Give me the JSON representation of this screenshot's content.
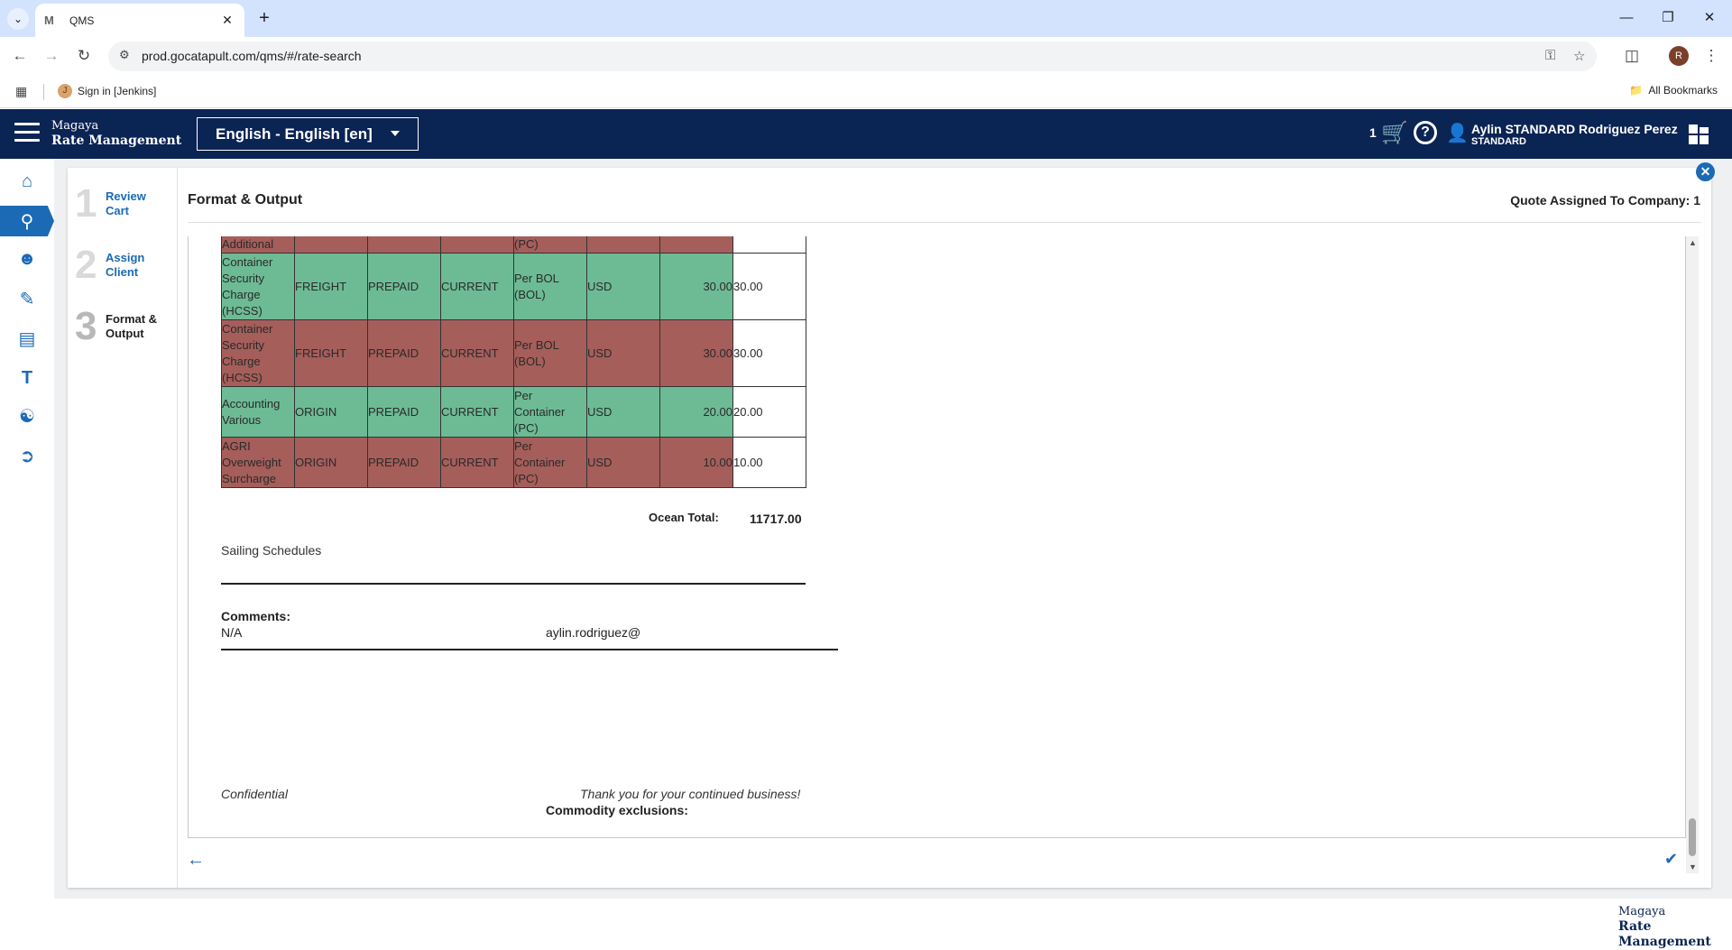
{
  "browser": {
    "tab_title": "QMS",
    "tab_favicon": "M",
    "url": "prod.gocatapult.com/qms/#/rate-search",
    "bookmark_label": "Sign in [Jenkins]",
    "all_bookmarks_label": "All Bookmarks",
    "profile_initial": "R"
  },
  "header": {
    "brand_top": "Magaya",
    "brand_bottom": "Rate Management",
    "language": "English - English [en]",
    "cart_count": "1",
    "user_name": "Aylin STANDARD Rodriguez Perez",
    "user_role": "STANDARD"
  },
  "wizard": {
    "steps": [
      {
        "number": "1",
        "label": "Review Cart"
      },
      {
        "number": "2",
        "label": "Assign Client"
      },
      {
        "number": "3",
        "label": "Format & Output"
      }
    ],
    "active_step": 3,
    "title": "Format & Output",
    "quote_assigned": "Quote Assigned To Company: 1"
  },
  "document": {
    "charges": [
      {
        "name": "Additional",
        "type": "",
        "payment": "",
        "status": "",
        "unit": "(PC)",
        "currency": "",
        "amount": "",
        "total": "",
        "color": "red",
        "partial": true
      },
      {
        "name": "Container Security Charge (HCSS)",
        "type": "FREIGHT",
        "payment": "PREPAID",
        "status": "CURRENT",
        "unit": "Per BOL (BOL)",
        "currency": "USD",
        "amount": "30.00",
        "total": "30.00",
        "color": "green"
      },
      {
        "name": "Container Security Charge (HCSS)",
        "type": "FREIGHT",
        "payment": "PREPAID",
        "status": "CURRENT",
        "unit": "Per BOL (BOL)",
        "currency": "USD",
        "amount": "30.00",
        "total": "30.00",
        "color": "red"
      },
      {
        "name": "Accounting Various",
        "type": "ORIGIN",
        "payment": "PREPAID",
        "status": "CURRENT",
        "unit": "Per Container (PC)",
        "currency": "USD",
        "amount": "20.00",
        "total": "20.00",
        "color": "green"
      },
      {
        "name": "AGRI Overweight Surcharge",
        "type": "ORIGIN",
        "payment": "PREPAID",
        "status": "CURRENT",
        "unit": "Per Container (PC)",
        "currency": "USD",
        "amount": "10.00",
        "total": "10.00",
        "color": "red"
      }
    ],
    "ocean_total_label": "Ocean Total:",
    "ocean_total_value": "11717.00",
    "sailing_schedules": "Sailing Schedules",
    "comments_label": "Comments:",
    "comments_value": "N/A",
    "email": "aylin.rodriguez@",
    "confidential": "Confidential",
    "thanks": "Thank you for your continued business!",
    "commodity_label": "Commodity exclusions:"
  },
  "colors": {
    "navy": "#0a2453",
    "accent": "#1b6ab5",
    "row_green": "#6dbb95",
    "row_red": "#a55e5a"
  },
  "footer": {
    "brand_top": "Magaya",
    "brand_bottom": "Rate Management"
  }
}
